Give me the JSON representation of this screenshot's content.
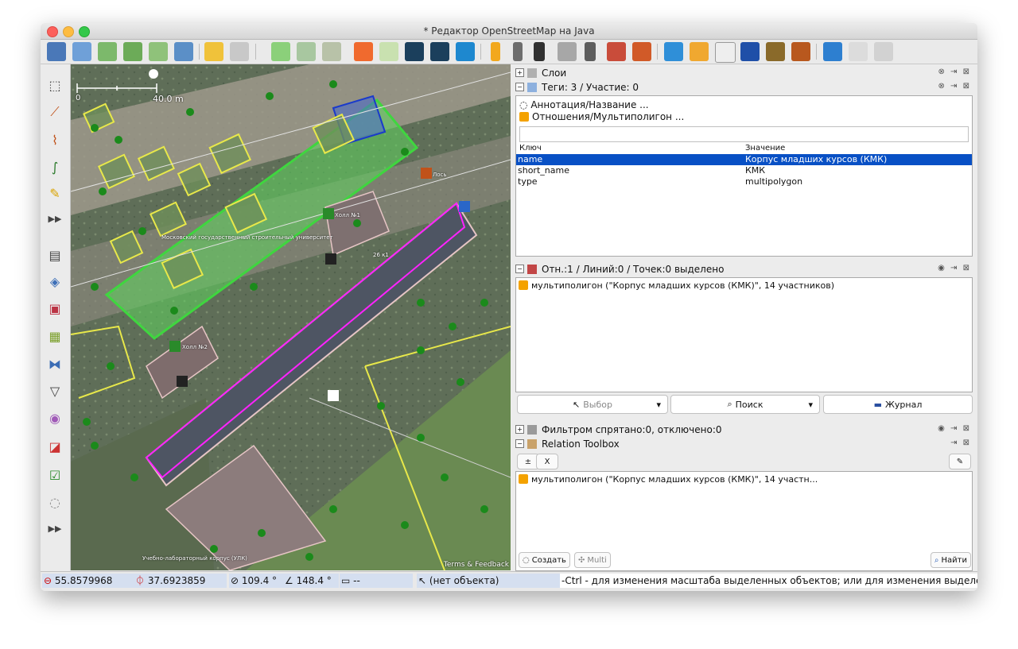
{
  "window": {
    "title": "* Редактор OpenStreetMap на Java"
  },
  "colors": {
    "accent": "#0850c5",
    "building_outline": "#e8e84a",
    "selected_relation": "#ff22ff",
    "landuse_green": "#3fd63f"
  },
  "map": {
    "scale_zero": "0",
    "scale_label": "40.0 m",
    "labels": {
      "lose": "Лось",
      "holl1": "Холл №1",
      "holl2": "Холл №2",
      "university": "Московский государственный строительный университет",
      "lab_building": "Учебно-лабораторный корпус (УЛК)",
      "house26": "26 к1"
    },
    "terms": "Terms & Feedback"
  },
  "layers_panel": {
    "title": "Слои"
  },
  "tags_panel": {
    "title": "Теги: 3 / Участие: 0",
    "annotation": "Аннотация/Название ...",
    "relations": "Отношения/Мультиполигон ...",
    "col_key": "Ключ",
    "col_value": "Значение",
    "rows": [
      {
        "key": "name",
        "value": "Корпус младших курсов (КМК)"
      },
      {
        "key": "short_name",
        "value": "КМК"
      },
      {
        "key": "type",
        "value": "multipolygon"
      }
    ]
  },
  "selection_panel": {
    "title": "Отн.:1 / Линий:0 / Точек:0 выделено",
    "item": "мультиполигон (\"Корпус младших курсов (КМК)\", 14 участников)",
    "btn_select": "Выбор",
    "btn_search": "Поиск",
    "btn_journal": "Журнал"
  },
  "filter_panel": {
    "title": "Фильтром спрятано:0, отключено:0"
  },
  "relation_toolbox": {
    "title": "Relation Toolbox",
    "item": "мультиполигон (\"Корпус младших курсов (КМК)\", 14 участн...",
    "btn_create": "Создать",
    "btn_multi": "Multi",
    "btn_find": "Найти"
  },
  "status": {
    "lat": "55.8579968",
    "lon": "37.6923859",
    "heading": "109.4 °",
    "angle": "148.4 °",
    "dist": "--",
    "object": "(нет объекта)",
    "help": "-Ctrl - для изменения масштаба выделенных объектов; или для изменения выделения"
  }
}
